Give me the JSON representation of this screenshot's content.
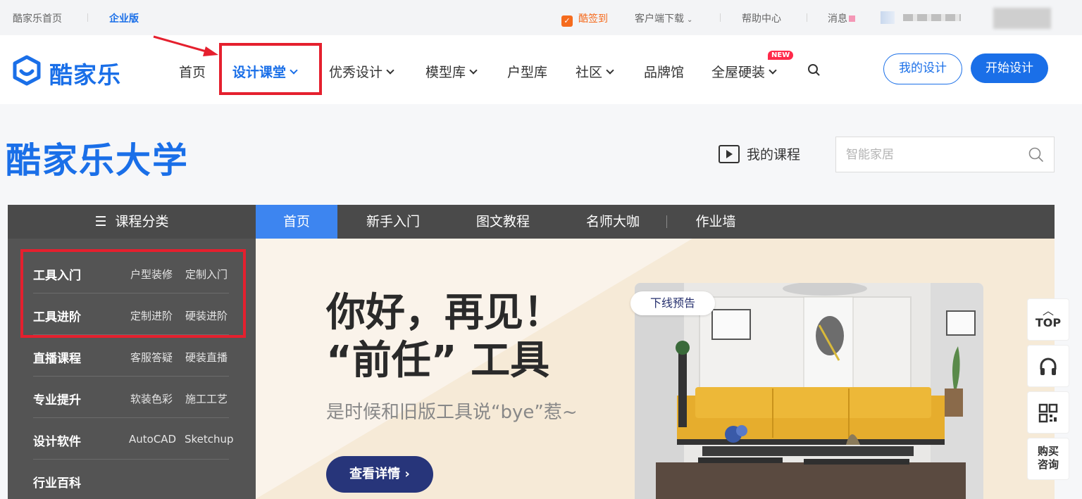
{
  "topbar": {
    "home": "酷家乐首页",
    "enterprise": "企业版",
    "sign_in": "酷签到",
    "client_download": "客户端下载",
    "help_center": "帮助中心",
    "messages": "消息"
  },
  "nav": {
    "logo": "酷家乐",
    "items": [
      {
        "label": "首页"
      },
      {
        "label": "设计课堂"
      },
      {
        "label": "优秀设计"
      },
      {
        "label": "模型库"
      },
      {
        "label": "户型库"
      },
      {
        "label": "社区"
      },
      {
        "label": "品牌馆"
      },
      {
        "label": "全屋硬装"
      }
    ],
    "new_badge": "NEW",
    "my_design": "我的设计",
    "start_design": "开始设计"
  },
  "university": {
    "title": "酷家乐大学",
    "my_course": "我的课程",
    "search_placeholder": "智能家居"
  },
  "categories": {
    "header": "课程分类",
    "rows": [
      {
        "name": "工具入门",
        "subs": [
          "户型装修",
          "定制入门"
        ]
      },
      {
        "name": "工具进阶",
        "subs": [
          "定制进阶",
          "硬装进阶"
        ]
      },
      {
        "name": "直播课程",
        "subs": [
          "客服答疑",
          "硬装直播"
        ]
      },
      {
        "name": "专业提升",
        "subs": [
          "软装色彩",
          "施工工艺"
        ]
      },
      {
        "name": "设计软件",
        "subs": [
          "AutoCAD",
          "Sketchup"
        ]
      },
      {
        "name": "行业百科",
        "subs": []
      }
    ]
  },
  "tabs": [
    {
      "label": "首页"
    },
    {
      "label": "新手入门"
    },
    {
      "label": "图文教程"
    },
    {
      "label": "名师大咖"
    },
    {
      "label": "作业墙"
    }
  ],
  "banner": {
    "line1": "你好，再见！",
    "line2": "“前任” 工具",
    "subtitle": "是时候和旧版工具说“bye”惹~",
    "button": "查看详情 ›",
    "tag": "下线预告"
  },
  "tools": {
    "top": "TOP",
    "buy_line1": "购买",
    "buy_line2": "咨询"
  },
  "colors": {
    "brand_blue": "#1a6fe8",
    "annotation_red": "#e5202e",
    "banner_button": "#27357a"
  }
}
